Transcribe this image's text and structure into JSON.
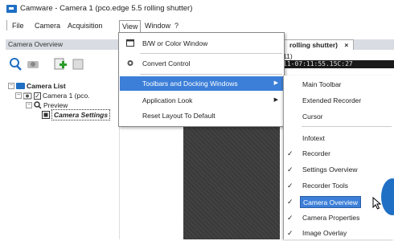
{
  "window": {
    "title": "Camware - Camera 1 (pco.edge 5.5 rolling shutter)"
  },
  "menubar": {
    "items": [
      "File",
      "Camera",
      "Acquisition",
      "View",
      "Window",
      "?"
    ],
    "active": "View"
  },
  "panel": {
    "title": "Camera Overview"
  },
  "document_tab": {
    "label": "rolling shutter)",
    "close": "×",
    "sub": "11)",
    "info": "11-07:11:55.15C:27"
  },
  "tree": {
    "root": "Camera List",
    "camera": "Camera 1 (pco.",
    "preview": "Preview",
    "settings": "Camera Settings"
  },
  "view_menu": [
    {
      "label": "B/W or Color Window",
      "icon": "window-icon",
      "has_submenu": false
    },
    {
      "label": "Convert Control",
      "icon": "convert-icon",
      "has_submenu": false
    },
    {
      "label": "Toolbars and Docking Windows",
      "icon": "",
      "has_submenu": true,
      "highlighted": true
    },
    {
      "label": "Application Look",
      "icon": "",
      "has_submenu": true
    },
    {
      "label": "Reset Layout To Default",
      "icon": "",
      "has_submenu": false
    }
  ],
  "submenu": [
    {
      "label": "Main Toolbar",
      "checked": false
    },
    {
      "label": "Extended Recorder",
      "checked": false
    },
    {
      "label": "Cursor",
      "checked": false
    },
    {
      "label": "Infotext",
      "checked": false
    },
    {
      "label": "Recorder",
      "checked": true
    },
    {
      "label": "Settings Overview",
      "checked": true
    },
    {
      "label": "Recorder Tools",
      "checked": true
    },
    {
      "label": "Camera Overview",
      "checked": true,
      "highlighted": true
    },
    {
      "label": "Camera Properties",
      "checked": true
    },
    {
      "label": "Image Overlay",
      "checked": true
    }
  ],
  "colors": {
    "accent": "#3c7fd8",
    "brand": "#1f6fc4",
    "panel_header": "#d9dde3"
  }
}
